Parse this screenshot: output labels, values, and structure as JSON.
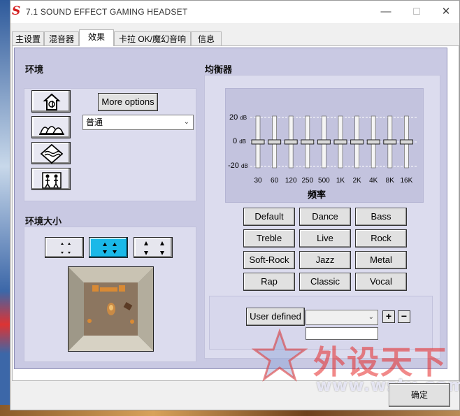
{
  "window": {
    "title": "7.1 SOUND EFFECT GAMING HEADSET",
    "app_logo": "S",
    "minimize": "—",
    "maximize": "☐",
    "close": "✕"
  },
  "tabs": [
    {
      "label": "主设置"
    },
    {
      "label": "混音器"
    },
    {
      "label": "效果"
    },
    {
      "label": "卡拉 OK/魔幻音响"
    },
    {
      "label": "信息"
    }
  ],
  "environment": {
    "title": "环境",
    "icons": [
      "concert-hall-icon",
      "opera-house-icon",
      "underwater-icon",
      "bathroom-icon"
    ],
    "more_options": "More options",
    "selected": "普通"
  },
  "environment_size": {
    "title": "环境大小",
    "selected_index": 1
  },
  "equalizer": {
    "title": "均衡器",
    "db_top": "20",
    "db_mid": "0",
    "db_bottom": "-20",
    "db_unit": "dB",
    "bands": [
      "30",
      "60",
      "120",
      "250",
      "500",
      "1K",
      "2K",
      "4K",
      "8K",
      "16K"
    ],
    "band_levels_db": [
      0,
      0,
      0,
      0,
      0,
      0,
      0,
      0,
      0,
      0
    ],
    "freq_title": "频率",
    "presets": [
      "Default",
      "Dance",
      "Bass",
      "Treble",
      "Live",
      "Rock",
      "Soft-Rock",
      "Jazz",
      "Metal",
      "Rap",
      "Classic",
      "Vocal"
    ],
    "user_defined": "User defined",
    "user_select_value": "",
    "add": "+",
    "remove": "−"
  },
  "footer": {
    "ok": "确定"
  },
  "watermark": {
    "text": "外设天下",
    "url": "www.wstx.com"
  },
  "colors": {
    "panel": "#c9c9e3",
    "subpanel": "#dcdcee",
    "selected_size": "#1ab8e8"
  }
}
